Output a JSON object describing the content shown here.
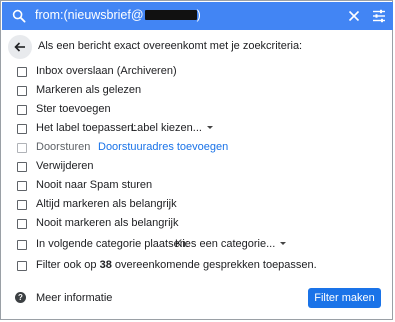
{
  "search": {
    "query_text": "from:(nieuwsbrief@",
    "query_suffix": ")"
  },
  "header": {
    "text": "Als een bericht exact overeenkomt met je zoekcriteria:"
  },
  "options": {
    "skip_inbox": "Inbox overslaan (Archiveren)",
    "mark_read": "Markeren als gelezen",
    "star": "Ster toevoegen",
    "apply_label": "Het label toepassen:",
    "label_dropdown": "Label kiezen...",
    "forward": "Doorsturen",
    "forward_link": "Doorstuuradres toevoegen",
    "delete": "Verwijderen",
    "never_spam": "Nooit naar Spam sturen",
    "always_important": "Altijd markeren als belangrijk",
    "never_important": "Nooit markeren als belangrijk",
    "category": "In volgende categorie plaatsen:",
    "category_dropdown": "Kies een categorie...",
    "also_apply_prefix": "Filter ook op",
    "also_apply_count": "38",
    "also_apply_suffix": "overeenkomende gesprekken toepassen."
  },
  "footer": {
    "more_info": "Meer informatie",
    "create_filter": "Filter maken"
  },
  "colors": {
    "search_bar": "#4285f4",
    "link": "#1a73e8",
    "button": "#1a73e8"
  },
  "icons": [
    "search-icon",
    "close-icon",
    "tune-icon",
    "arrow-back-icon",
    "help-icon"
  ]
}
